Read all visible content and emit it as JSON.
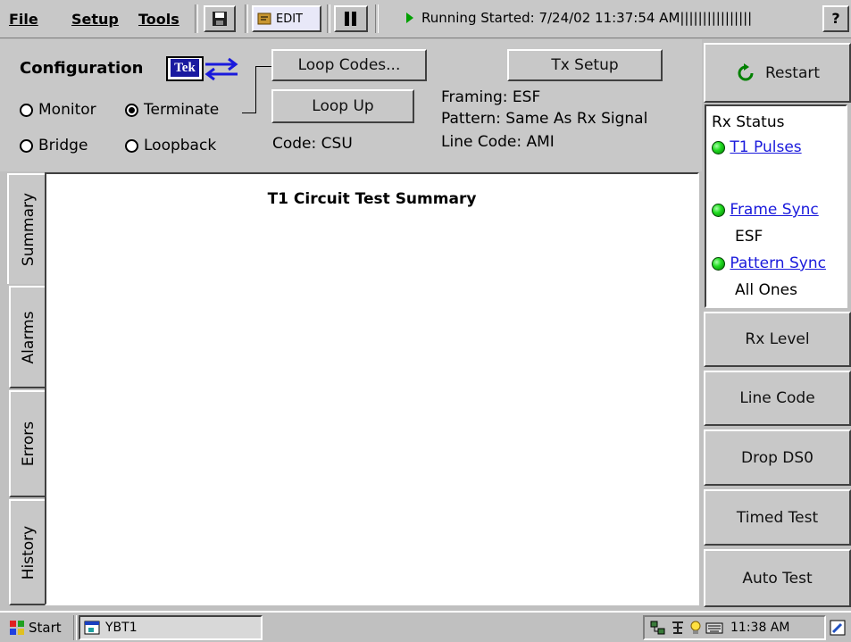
{
  "menu": {
    "file": "File",
    "setup": "Setup",
    "tools": "Tools",
    "edit_label": "EDIT",
    "status": "Running Started: 7/24/02 11:37:54 AM||||||||||||||||",
    "help": "?"
  },
  "config": {
    "title": "Configuration",
    "logo_text": "Tek",
    "modes": {
      "monitor": "Monitor",
      "terminate": "Terminate",
      "bridge": "Bridge",
      "loopback": "Loopback"
    },
    "selected_mode": "terminate",
    "loop_codes_button": "Loop Codes...",
    "loop_up_button": "Loop Up",
    "code": "Code: CSU",
    "tx_setup_button": "Tx Setup",
    "framing": "Framing: ESF",
    "pattern": "Pattern: Same As Rx Signal",
    "line_code": "Line Code:  AMI"
  },
  "side": {
    "restart": "Restart",
    "rx_status_title": "Rx Status",
    "t1_pulses": "T1 Pulses",
    "frame_sync": "Frame Sync",
    "frame_sync_value": "ESF",
    "pattern_sync": "Pattern Sync",
    "pattern_sync_value": "All Ones",
    "rx_level": "Rx Level",
    "line_code": "Line Code",
    "drop_ds0": "Drop DS0",
    "timed_test": "Timed Test",
    "auto_test": "Auto Test"
  },
  "tabs": [
    "Summary",
    "Alarms",
    "Errors",
    "History"
  ],
  "content": {
    "title": "T1 Circuit Test Summary"
  },
  "taskbar": {
    "start": "Start",
    "task": "YBT1",
    "clock": "11:38 AM"
  }
}
